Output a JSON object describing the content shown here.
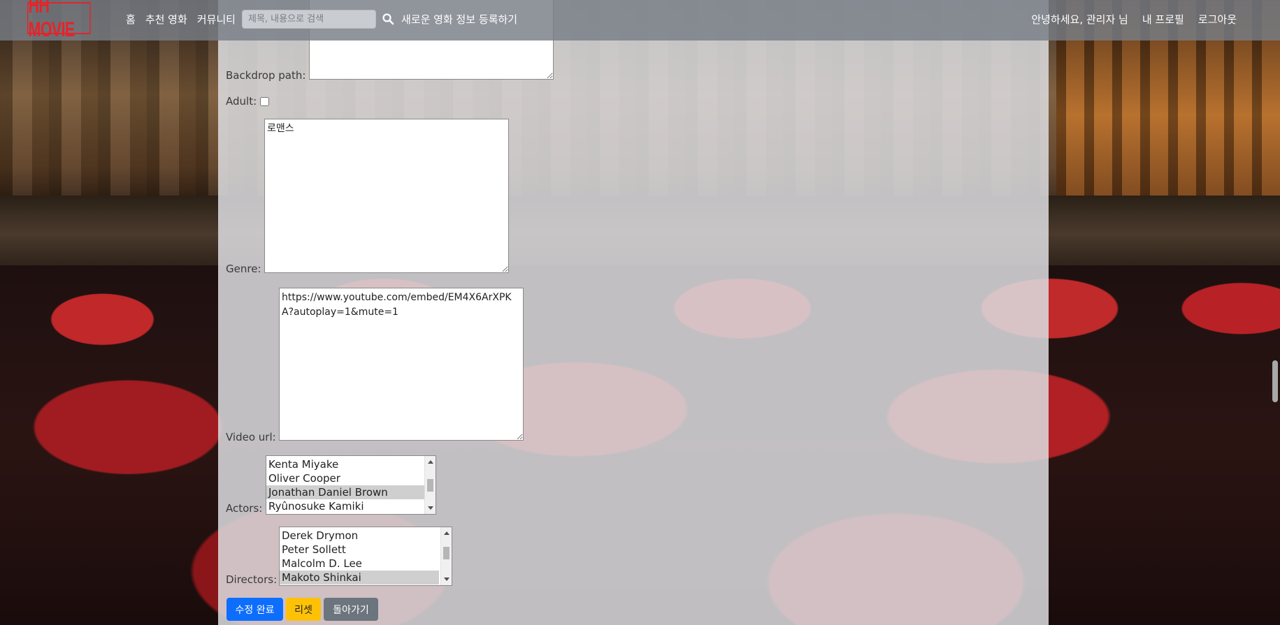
{
  "navbar": {
    "logo": "HH MOVIE",
    "links": [
      "홈",
      "추천 영화",
      "커뮤니티"
    ],
    "search_placeholder": "제목, 내용으로 검색",
    "register_link": "새로운 영화 정보 등록하기",
    "greeting": "안녕하세요, 관리자 님",
    "profile_link": "내 프로필",
    "logout_link": "로그아웃"
  },
  "form": {
    "backdrop_label": "Backdrop path:",
    "backdrop_value": "",
    "adult_label": "Adult:",
    "adult_checked": false,
    "genre_label": "Genre:",
    "genre_value": "로맨스",
    "video_label": "Video url:",
    "video_value": "https://www.youtube.com/embed/EM4X6ArXPKA?autoplay=1&mute=1",
    "actors_label": "Actors:",
    "actors_options": [
      "Kenta Miyake",
      "Oliver Cooper",
      "Jonathan Daniel Brown",
      "Ryûnosuke Kamiki"
    ],
    "actors_selected_index": 2,
    "directors_label": "Directors:",
    "directors_options": [
      "Derek Drymon",
      "Peter Sollett",
      "Malcolm D. Lee",
      "Makoto Shinkai"
    ],
    "directors_selected_index": 3
  },
  "buttons": {
    "submit": "수정 완료",
    "reset": "리셋",
    "back": "돌아가기"
  },
  "colors": {
    "primary": "#0d6efd",
    "warning": "#ffc107",
    "secondary": "#6c757d",
    "logo": "#e0262c"
  }
}
